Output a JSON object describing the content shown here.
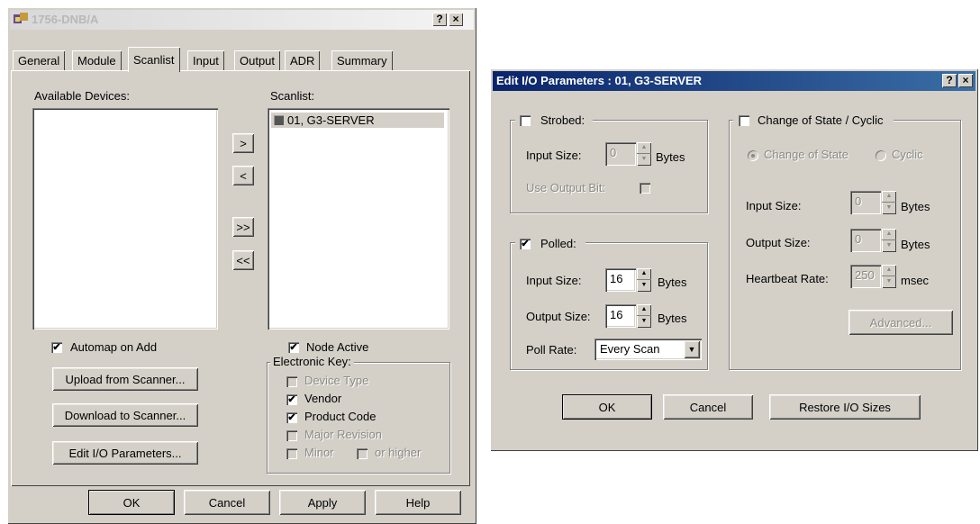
{
  "scanner_window": {
    "title": "1756-DNB/A",
    "help_btn": "?",
    "close_btn": "×",
    "tabs": [
      "General",
      "Module",
      "Scanlist",
      "Input",
      "Output",
      "ADR",
      "Summary"
    ],
    "active_tab": "Scanlist",
    "available_devices_label": "Available Devices:",
    "scanlist_label": "Scanlist:",
    "scanlist_items": [
      "01, G3-SERVER"
    ],
    "move_buttons": [
      ">",
      "<",
      ">>",
      "<<"
    ],
    "automap_label": "Automap on Add",
    "automap_checked": true,
    "node_active_label": "Node Active",
    "node_active_checked": true,
    "upload_button": "Upload from Scanner...",
    "download_button": "Download to Scanner...",
    "edit_io_button": "Edit I/O Parameters...",
    "electronic_key": {
      "label": "Electronic Key:",
      "device_type": "Device Type",
      "vendor": "Vendor",
      "product_code": "Product Code",
      "major_revision": "Major Revision",
      "minor": "Minor",
      "or_higher": "or higher"
    },
    "ok_button": "OK",
    "cancel_button": "Cancel",
    "apply_button": "Apply",
    "help_button": "Help"
  },
  "io_dialog": {
    "title": "Edit I/O Parameters : 01, G3-SERVER",
    "help_btn": "?",
    "close_btn": "×",
    "strobed": {
      "label": "Strobed:",
      "checked": false,
      "input_size_label": "Input Size:",
      "input_size_value": "0",
      "bytes_label": "Bytes",
      "use_output_bit_label": "Use Output Bit:"
    },
    "polled": {
      "label": "Polled:",
      "checked": true,
      "input_size_label": "Input Size:",
      "input_size_value": "16",
      "output_size_label": "Output Size:",
      "output_size_value": "16",
      "bytes_label": "Bytes",
      "poll_rate_label": "Poll Rate:",
      "poll_rate_value": "Every Scan"
    },
    "cos": {
      "label": "Change of State / Cyclic",
      "checked": false,
      "change_of_state_label": "Change of State",
      "cyclic_label": "Cyclic",
      "input_size_label": "Input Size:",
      "input_size_value": "0",
      "output_size_label": "Output Size:",
      "output_size_value": "0",
      "heartbeat_label": "Heartbeat Rate:",
      "heartbeat_value": "250",
      "bytes_label": "Bytes",
      "msec_label": "msec",
      "advanced_button": "Advanced..."
    },
    "ok_button": "OK",
    "cancel_button": "Cancel",
    "restore_button": "Restore I/O Sizes"
  }
}
